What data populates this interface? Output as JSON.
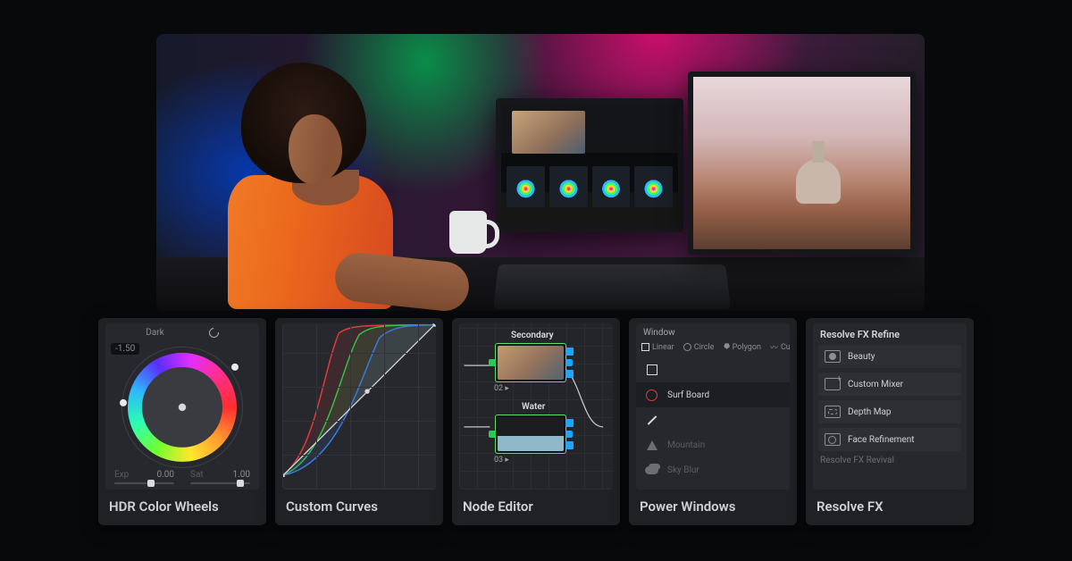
{
  "panels": {
    "hdr": {
      "title": "HDR Color Wheels",
      "wheel_name": "Dark",
      "badge_value": "-1.50",
      "sliders": [
        {
          "label": "Exp",
          "value": "0.00",
          "pos": 0.55
        },
        {
          "label": "Sat",
          "value": "1.00",
          "pos": 0.78
        }
      ]
    },
    "curves": {
      "title": "Custom Curves"
    },
    "nodes": {
      "title": "Node Editor",
      "n1": {
        "label": "Secondary",
        "num": "02"
      },
      "n2": {
        "label": "Water",
        "num": "03"
      }
    },
    "power": {
      "title": "Power Windows",
      "section": "Window",
      "tabs": {
        "linear": "Linear",
        "circle": "Circle",
        "polygon": "Polygon",
        "curve": "Curve"
      },
      "rows": {
        "surf": "Surf Board",
        "mountain": "Mountain",
        "sky": "Sky Blur"
      }
    },
    "fx": {
      "title": "Resolve FX",
      "section": "Resolve FX Refine",
      "items": {
        "beauty": "Beauty",
        "mixer": "Custom Mixer",
        "depth": "Depth Map",
        "face": "Face Refinement"
      },
      "sub": "Resolve FX Revival"
    }
  }
}
